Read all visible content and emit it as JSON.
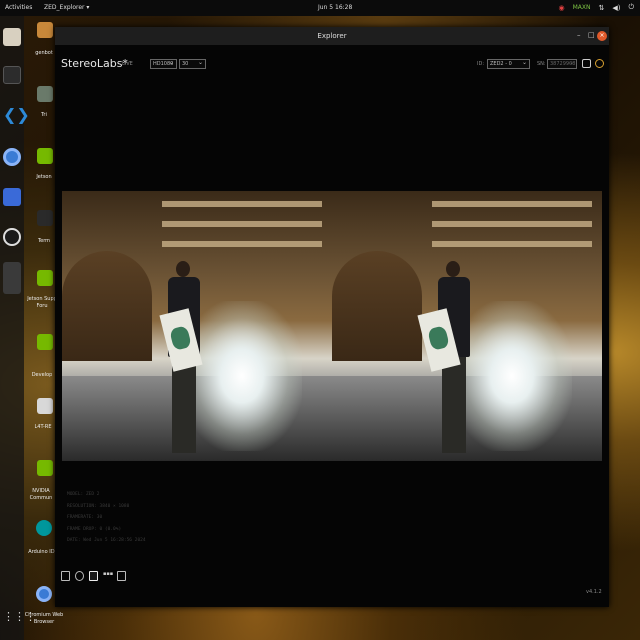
{
  "topbar": {
    "activities": "Activities",
    "app_menu": "ZED_Explorer ▾",
    "clock": "Jun 5  16:28",
    "tray_text": "MAXN"
  },
  "desktop": {
    "icons": [
      {
        "label": "genbot"
      },
      {
        "label": "Tri"
      },
      {
        "label": "Jetson"
      },
      {
        "label": "Term"
      },
      {
        "label": "Jetson Supp Foru"
      },
      {
        "label": "Develop"
      },
      {
        "label": "L4T-RE"
      },
      {
        "label": "NVIDIA Commun"
      },
      {
        "label": "Arduino IDE"
      },
      {
        "label": "Chromium Web Browser"
      }
    ]
  },
  "window": {
    "title": "Explorer",
    "minimize": "–",
    "maximize": "□",
    "close": "×"
  },
  "app": {
    "brand": "StereoLabs*",
    "live_label": "LIVE",
    "resolution": "HD1080",
    "fps": "30",
    "id_label": "ID:",
    "camera": "ZED2 - 0",
    "sn_label": "SN:",
    "serial_placeholder": "38729908",
    "version": "v4.1.2"
  },
  "info_lines": [
    "MODEL: ZED 2",
    "RESOLUTION: 3840 × 1080",
    "FRAMERATE: 30",
    "FRAME DROP: 0 (0.0%)",
    "DATE: Wed Jun 5 16:28:56 2024"
  ],
  "icons": {
    "folder": "folder-icon",
    "stream": "stream-icon",
    "record": "record-icon",
    "settings": "settings-icon",
    "camera": "camera-icon"
  }
}
